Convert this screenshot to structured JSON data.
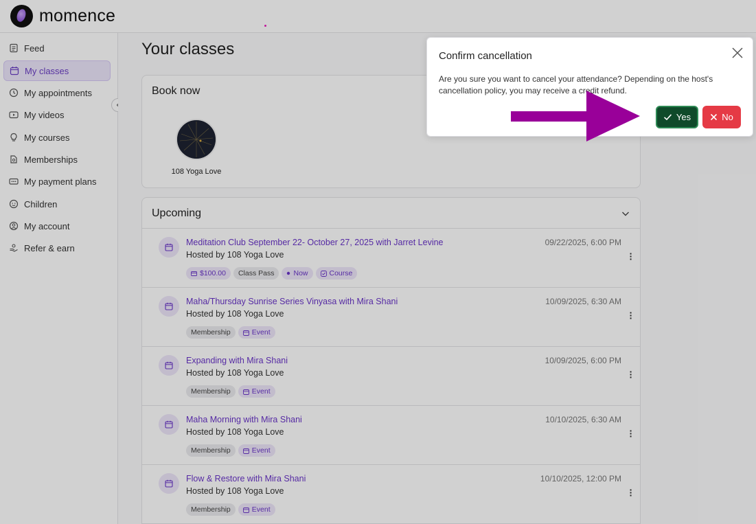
{
  "app": {
    "name": "momence"
  },
  "sidebar": {
    "items": [
      {
        "label": "Feed",
        "icon": "feed-icon"
      },
      {
        "label": "My classes",
        "icon": "calendar-icon",
        "active": true
      },
      {
        "label": "My appointments",
        "icon": "clock-icon"
      },
      {
        "label": "My videos",
        "icon": "video-icon"
      },
      {
        "label": "My courses",
        "icon": "lightbulb-icon"
      },
      {
        "label": "Memberships",
        "icon": "membership-icon"
      },
      {
        "label": "My payment plans",
        "icon": "payment-icon"
      },
      {
        "label": "Children",
        "icon": "children-icon"
      },
      {
        "label": "My account",
        "icon": "account-icon"
      },
      {
        "label": "Refer & earn",
        "icon": "refer-icon"
      }
    ]
  },
  "main": {
    "title": "Your classes",
    "book_now": {
      "title": "Book now",
      "studio": "108 Yoga Love"
    },
    "upcoming": {
      "title": "Upcoming",
      "events": [
        {
          "title": "Meditation Club September 22- October 27, 2025 with Jarret Levine",
          "host": "Hosted by 108 Yoga Love",
          "date": "09/22/2025, 6:00 PM",
          "badges": [
            {
              "label": "$100.00",
              "style": "purple",
              "icon": "card"
            },
            {
              "label": "Class Pass",
              "style": "gray"
            },
            {
              "label": "Now",
              "style": "purple",
              "icon": "dot"
            },
            {
              "label": "Course",
              "style": "purple",
              "icon": "check"
            }
          ]
        },
        {
          "title": "Maha/Thursday Sunrise Series Vinyasa with Mira Shani",
          "host": "Hosted by 108 Yoga Love",
          "date": "10/09/2025, 6:30 AM",
          "badges": [
            {
              "label": "Membership",
              "style": "gray"
            },
            {
              "label": "Event",
              "style": "purple",
              "icon": "calendar"
            }
          ]
        },
        {
          "title": "Expanding with Mira Shani",
          "host": "Hosted by 108 Yoga Love",
          "date": "10/09/2025, 6:00 PM",
          "badges": [
            {
              "label": "Membership",
              "style": "gray"
            },
            {
              "label": "Event",
              "style": "purple",
              "icon": "calendar"
            }
          ]
        },
        {
          "title": "Maha Morning with Mira Shani",
          "host": "Hosted by 108 Yoga Love",
          "date": "10/10/2025, 6:30 AM",
          "badges": [
            {
              "label": "Membership",
              "style": "gray"
            },
            {
              "label": "Event",
              "style": "purple",
              "icon": "calendar"
            }
          ]
        },
        {
          "title": "Flow & Restore with Mira Shani",
          "host": "Hosted by 108 Yoga Love",
          "date": "10/10/2025, 12:00 PM",
          "badges": [
            {
              "label": "Membership",
              "style": "gray"
            },
            {
              "label": "Event",
              "style": "purple",
              "icon": "calendar"
            }
          ]
        }
      ]
    }
  },
  "dialog": {
    "title": "Confirm cancellation",
    "message": "Are you sure you want to cancel your attendance? Depending on the host's cancellation policy, you may receive a credit refund.",
    "yes_label": "Yes",
    "no_label": "No"
  },
  "colors": {
    "accent": "#6a35c8",
    "yes_button": "#0f4a2a",
    "no_button": "#e53a45",
    "annotation_arrow": "#990099"
  }
}
